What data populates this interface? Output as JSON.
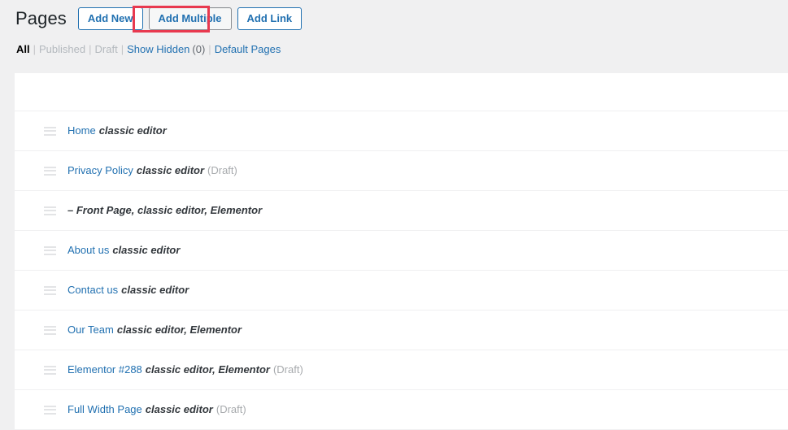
{
  "header": {
    "title": "Pages",
    "actions": [
      {
        "label": "Add New",
        "name": "add-new-button",
        "active": false
      },
      {
        "label": "Add Multiple",
        "name": "add-multiple-button",
        "active": true
      },
      {
        "label": "Add Link",
        "name": "add-link-button",
        "active": false
      }
    ]
  },
  "filters": {
    "all": {
      "label": "All",
      "state": "current"
    },
    "published": {
      "label": "Published",
      "state": "disabled"
    },
    "draft": {
      "label": "Draft",
      "state": "disabled"
    },
    "show_hidden": {
      "label": "Show Hidden",
      "state": "link"
    },
    "hidden_count": "(0)",
    "default_pages": {
      "label": "Default Pages",
      "state": "link"
    },
    "separator": "|"
  },
  "list": {
    "handle_icon": "drag-handle-icon",
    "rows": [
      {
        "link": "Home",
        "meta": "classic editor",
        "status": ""
      },
      {
        "link": "Privacy Policy",
        "meta": "classic editor",
        "status": "(Draft)"
      },
      {
        "link": "",
        "meta": "– Front Page, classic editor, Elementor",
        "status": ""
      },
      {
        "link": "About us",
        "meta": "classic editor",
        "status": ""
      },
      {
        "link": "Contact us",
        "meta": "classic editor",
        "status": ""
      },
      {
        "link": "Our Team",
        "meta": "classic editor, Elementor",
        "status": ""
      },
      {
        "link": "Elementor #288",
        "meta": "classic editor, Elementor",
        "status": "(Draft)"
      },
      {
        "link": "Full Width Page",
        "meta": "classic editor",
        "status": "(Draft)"
      }
    ]
  },
  "colors": {
    "page_background": "#f0f0f1",
    "panel_background": "#ffffff",
    "link_blue": "#2271b1",
    "highlight_red": "#e8394f",
    "muted_gray": "#a7aaad",
    "disabled_gray": "#b4b9be",
    "title_dark": "#1d2327"
  }
}
